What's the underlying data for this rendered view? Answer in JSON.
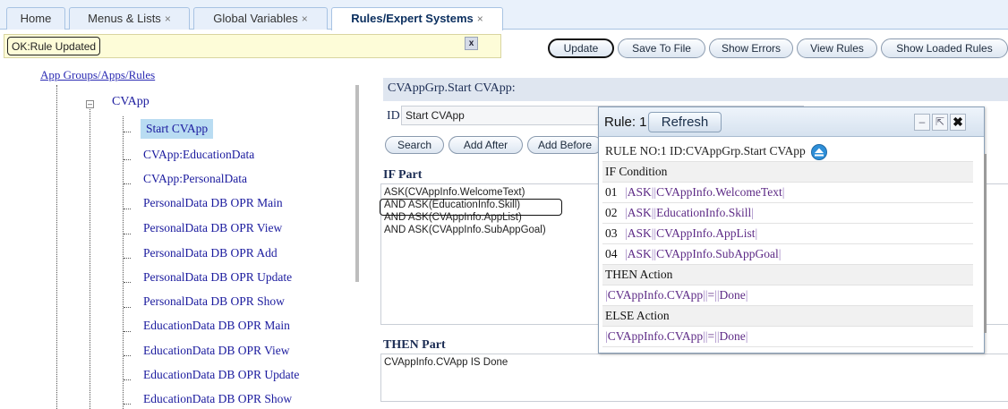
{
  "tabs": [
    {
      "label": "Home",
      "closable": false
    },
    {
      "label": "Menus & Lists",
      "closable": true
    },
    {
      "label": "Global Variables",
      "closable": true
    },
    {
      "label": "Rules/Expert Systems",
      "closable": true
    }
  ],
  "tab_close_glyph": "×",
  "status": {
    "text": "OK:Rule Updated",
    "close_glyph": "x"
  },
  "toolbar": {
    "update": "Update",
    "save_to_file": "Save To File",
    "show_errors": "Show Errors",
    "view_rules": "View Rules",
    "show_loaded_rules": "Show Loaded Rules"
  },
  "tree": {
    "root": "App Groups/Apps/Rules",
    "group": "CVApp",
    "items": [
      "Start CVApp",
      "CVApp:EducationData",
      "CVApp:PersonalData",
      "PersonalData DB OPR Main",
      "PersonalData DB OPR View",
      "PersonalData DB OPR Add",
      "PersonalData DB OPR Update",
      "PersonalData DB OPR Show",
      "EducationData DB OPR Main",
      "EducationData DB OPR View",
      "EducationData DB OPR Update",
      "EducationData DB OPR Show"
    ]
  },
  "form": {
    "rule_title": "CVAppGrp.Start CVApp:",
    "id_label": "ID",
    "id_value": "Start CVApp",
    "search": "Search",
    "add_after": "Add After",
    "add_before": "Add Before",
    "if_header": "IF Part",
    "if_lines": [
      "ASK(CVAppInfo.WelcomeText)",
      "AND ASK(EducationInfo.Skill)",
      "AND ASK(CVAppInfo.AppList)",
      "AND ASK(CVAppInfo.SubAppGoal)"
    ],
    "then_header": "THEN Part",
    "then_text": "CVAppInfo.CVApp IS Done"
  },
  "popup": {
    "title": "Rule: 1",
    "refresh": "Refresh",
    "rule_line": "RULE NO:1 ID:CVAppGrp.Start CVApp",
    "if_condition": "IF Condition",
    "conditions": [
      {
        "num": "01",
        "op": "ASK",
        "arg": "CVAppInfo.WelcomeText"
      },
      {
        "num": "02",
        "op": "ASK",
        "arg": "EducationInfo.Skill"
      },
      {
        "num": "03",
        "op": "ASK",
        "arg": "CVAppInfo.AppList"
      },
      {
        "num": "04",
        "op": "ASK",
        "arg": "CVAppInfo.SubAppGoal"
      }
    ],
    "then_action": "THEN Action",
    "then_var": "CVAppInfo.CVApp",
    "then_op": "=",
    "then_val": "Done",
    "else_action": "ELSE Action",
    "else_var": "CVAppInfo.CVApp",
    "else_op": "=",
    "else_val": "Done"
  },
  "colors": {
    "accent": "#1a1a9e",
    "selected_bg": "#b9dcf2",
    "status_bg": "#fdfcd8"
  }
}
